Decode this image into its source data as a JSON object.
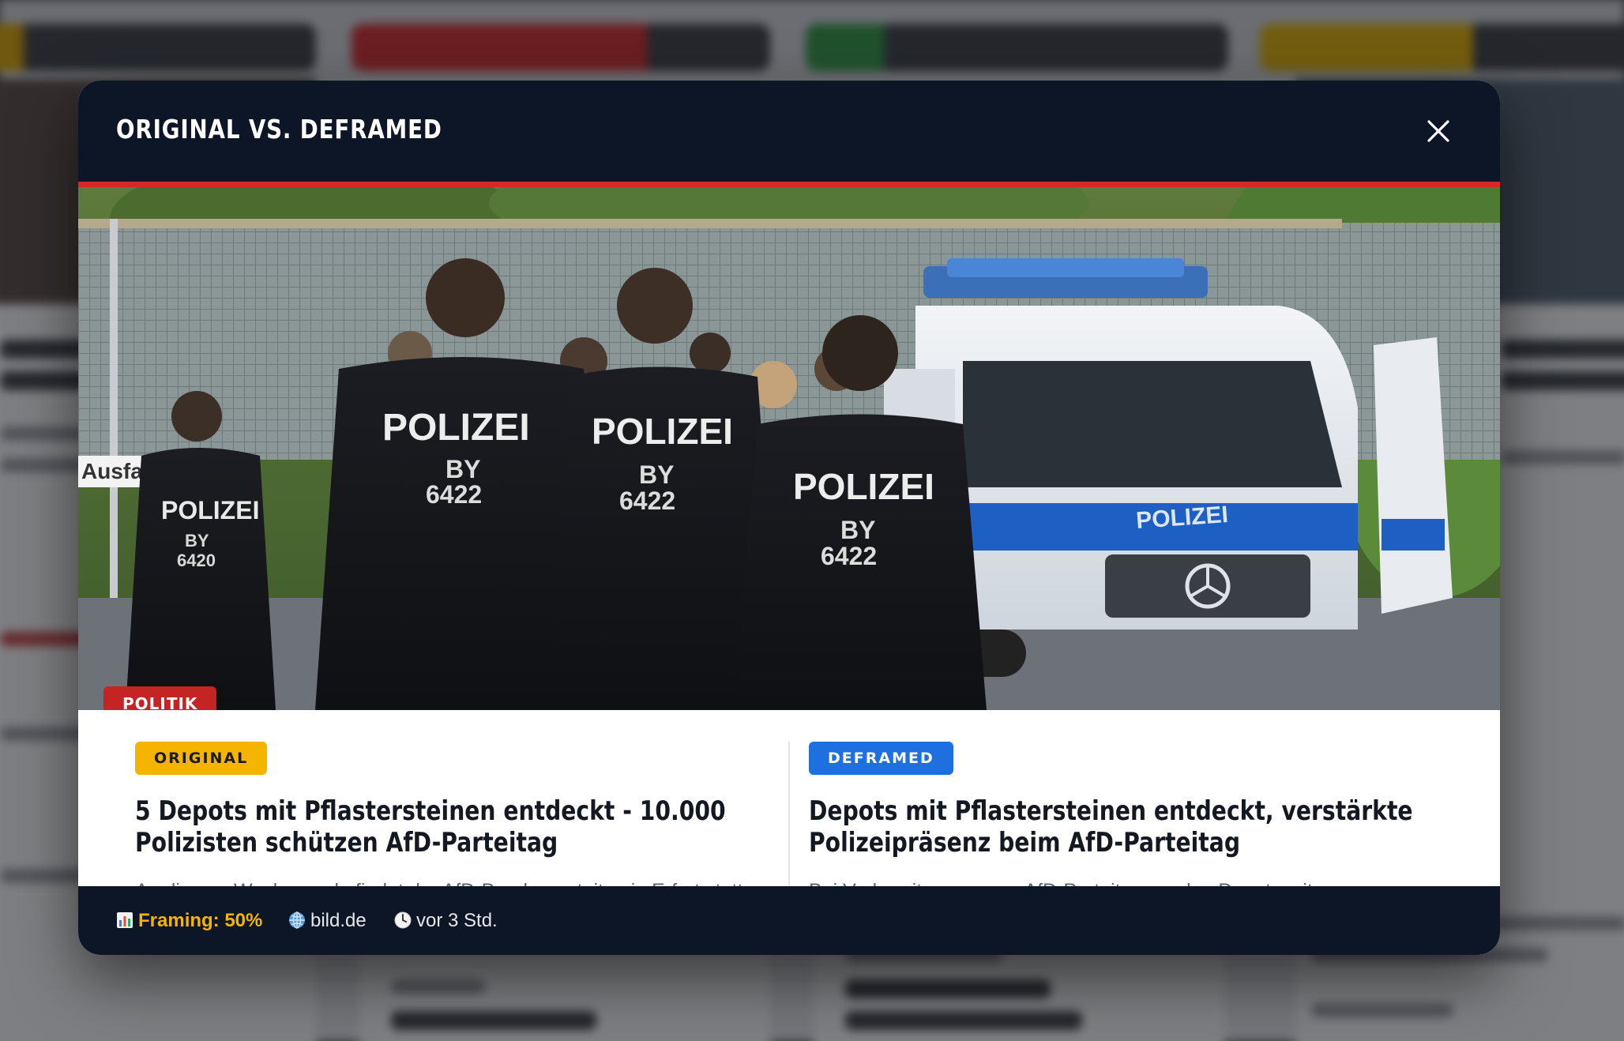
{
  "modal": {
    "title": "ORIGINAL VS. DEFRAMED",
    "close_icon": "close-icon"
  },
  "hero": {
    "category": "POLITIK",
    "image_text": {
      "sign": "Ausfahrt",
      "jacket": "POLIZEI",
      "unit_a": "BY",
      "unit_number_a": "6422",
      "unit_number_b": "6420",
      "van": "POLIZEI"
    }
  },
  "original": {
    "label": "ORIGINAL",
    "headline": "5 Depots mit Pflastersteinen entdeckt - 10.000 Polizisten schützen AfD-Parteitag",
    "teaser": "An diesem Wochenende findet der AfD-Bundesparteitag in Erfurt statt. Auf den Straßen wi..."
  },
  "deframed": {
    "label": "DEFRAMED",
    "headline": "Depots mit Pflastersteinen entdeckt, verstärkte Polizeipräsenz beim AfD-Parteitag",
    "teaser": "Bei Vorbereitungen zum AfD-Parteitag wurden Depots mit Pflastersteinen entdeckt, Polizei verstärkt."
  },
  "footer": {
    "framing_icon": "bar-chart-icon",
    "framing": "Framing: 50%",
    "source_icon": "globe-icon",
    "source": "bild.de",
    "time_icon": "clock-icon",
    "time": "vor 3 Std."
  },
  "colors": {
    "header_bg": "#0d1626",
    "accent_red": "#d62828",
    "original_yellow": "#f4b400",
    "deframed_blue": "#1e6fe0",
    "category_red": "#c52424"
  }
}
